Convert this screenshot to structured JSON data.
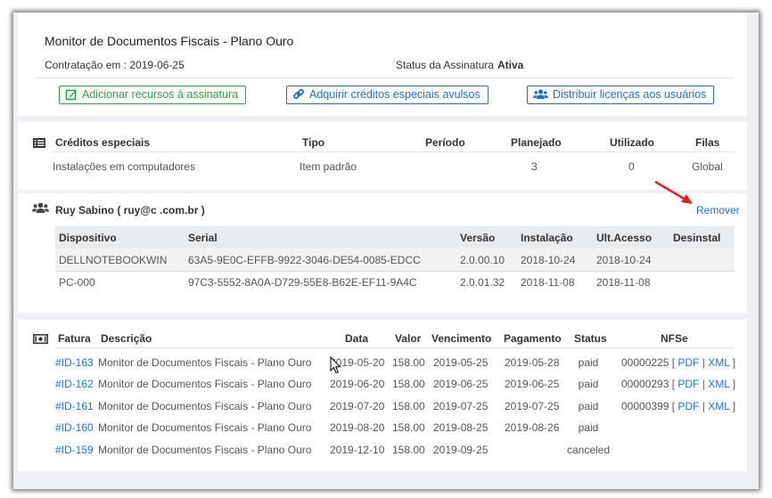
{
  "header": {
    "title": "Monitor de Documentos Fiscais - Plano Ouro",
    "contract_label": "Contratação em : 2019-06-25",
    "status_label": "Status da Assinatura",
    "status_value": "Ativa"
  },
  "actions": {
    "add_resources": "Adicionar recursos à assinatura",
    "buy_credits": "Adquirir créditos especiais avulsos",
    "distribute_licenses": "Distribuir licenças aos usuários"
  },
  "credits": {
    "headers": [
      "Créditos especiais",
      "Tipo",
      "Período",
      "Planejado",
      "Utilizado",
      "Filas"
    ],
    "row": [
      "Instalações em computadores",
      "Item padrão",
      "",
      "3",
      "0",
      "Global"
    ]
  },
  "user": {
    "name": "Ruy Sabino ( ruy@c             .com.br )",
    "remove_label": "Remover"
  },
  "devices": {
    "headers": [
      "Dispositivo",
      "Serial",
      "Versão",
      "Instalação",
      "Ult.Acesso",
      "Desinstal"
    ],
    "rows": [
      [
        "DELLNOTEBOOKWIN",
        "63A5-9E0C-EFFB-9922-3046-DE54-0085-EDCC",
        "2.0.00.10",
        "2018-10-24",
        "2018-10-24",
        ""
      ],
      [
        "PC-000",
        "97C3-5552-8A0A-D729-55E8-B62E-EF11-9A4C",
        "2.0.01.32",
        "2018-11-08",
        "2018-11-08",
        ""
      ]
    ]
  },
  "invoices": {
    "headers": [
      "Fatura",
      "Descrição",
      "Data",
      "Valor",
      "Vencimento",
      "Pagamento",
      "Status",
      "NFSe"
    ],
    "rows": [
      {
        "id": "#ID-163",
        "desc": "Monitor de Documentos Fiscais - Plano Ouro",
        "date": "2019-05-20",
        "value": "158.00",
        "due": "2019-05-25",
        "paid": "2019-05-28",
        "status": "paid",
        "nfse_num": "00000225",
        "pdf": "PDF",
        "xml": "XML"
      },
      {
        "id": "#ID-162",
        "desc": "Monitor de Documentos Fiscais - Plano Ouro",
        "date": "2019-06-20",
        "value": "158.00",
        "due": "2019-06-25",
        "paid": "2019-06-25",
        "status": "paid",
        "nfse_num": "00000293",
        "pdf": "PDF",
        "xml": "XML"
      },
      {
        "id": "#ID-161",
        "desc": "Monitor de Documentos Fiscais - Plano Ouro",
        "date": "2019-07-20",
        "value": "158.00",
        "due": "2019-07-25",
        "paid": "2019-07-25",
        "status": "paid",
        "nfse_num": "00000399",
        "pdf": "PDF",
        "xml": "XML"
      },
      {
        "id": "#ID-160",
        "desc": "Monitor de Documentos Fiscais - Plano Ouro",
        "date": "2019-08-20",
        "value": "158.00",
        "due": "2019-08-25",
        "paid": "2019-08-26",
        "status": "paid",
        "nfse_num": "",
        "pdf": "",
        "xml": ""
      },
      {
        "id": "#ID-159",
        "desc": "Monitor de Documentos Fiscais - Plano Ouro",
        "date": "2019-12-10",
        "value": "158.00",
        "due": "2019-09-25",
        "paid": "",
        "status": "canceled",
        "nfse_num": "",
        "pdf": "",
        "xml": ""
      }
    ]
  },
  "colors": {
    "accent_blue": "#1a73e8",
    "accent_green": "#28a745",
    "annotation_red": "#e0201c"
  },
  "icons": [
    "edit-icon",
    "link-icon",
    "users-icon",
    "list-icon",
    "user-group-icon",
    "money-icon",
    "red-arrow",
    "mouse-cursor"
  ]
}
